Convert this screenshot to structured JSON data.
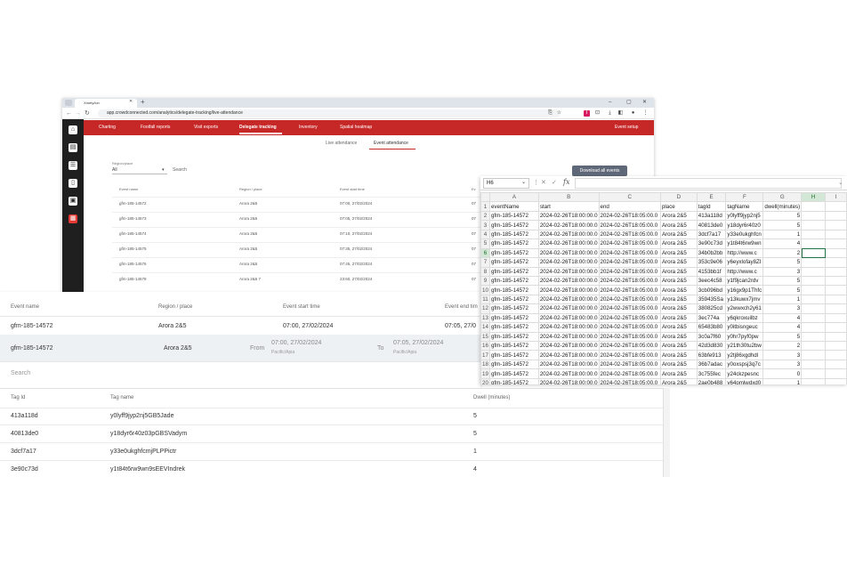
{
  "browser": {
    "tab_title": "Xmety/ion",
    "url": "app.crowdconnected.com/analytics/delegate-tracking/live-attendance",
    "win_min": "–",
    "win_max": "▢",
    "win_close": "✕",
    "app_nav": [
      "Charting",
      "Footfall reports",
      "Visit exports",
      "Delegate tracking",
      "Inventory",
      "Spatial heatmap",
      "Event setup"
    ],
    "sub_tabs": [
      "Live attendance",
      "Event attendance"
    ],
    "region_label": "Region/place",
    "region_value": "All",
    "search_label": "Search",
    "download_button": "Download all events",
    "table_headers": [
      "Event name",
      "Region / place",
      "Event start time",
      "Ev"
    ],
    "rows": [
      [
        "gfm-185-14572",
        "Arora 2&5",
        "07:00, 27/02/2024",
        "07"
      ],
      [
        "gfm-185-14573",
        "Arora 2&5",
        "07:05, 27/02/2024",
        "07"
      ],
      [
        "gfm-185-14574",
        "Arora 2&5",
        "07:10, 27/02/2024",
        "07"
      ],
      [
        "gfm-185-14575",
        "Arora 2&5",
        "07:35, 27/02/2024",
        "07"
      ],
      [
        "gfm-185-14576",
        "Arora 2&5",
        "07:45, 27/02/2024",
        "07"
      ],
      [
        "gfm-185-14578",
        "Arora 2&5 7",
        "23:60, 27/02/2024",
        "07"
      ]
    ]
  },
  "detail": {
    "headers": [
      "Event name",
      "Region / place",
      "Event start time",
      "Event end tim"
    ],
    "row1": [
      "gfm-185-14572",
      "Arora 2&5",
      "07:00, 27/02/2024",
      "07:05, 27/0"
    ],
    "row2": {
      "event": "gfm-185-14572",
      "place": "Arora 2&5",
      "from_label": "From",
      "from_time": "07:00, 27/02/2024",
      "from_tz": "Pacific/Apia",
      "to_label": "To",
      "to_time": "07:05, 27/02/2024",
      "to_tz": "Pacific/Apia"
    },
    "search_placeholder": "Search"
  },
  "tags": {
    "headers": [
      "Tag Id",
      "Tag name",
      "Dwell (minutes)"
    ],
    "rows": [
      [
        "413a118d",
        "y0lyff9jyp2nj5GB5Jade",
        "5"
      ],
      [
        "40813de0",
        "y18dyr6r40z03pGBSVadym",
        "5"
      ],
      [
        "3dcf7a17",
        "y33e0ukghfcmjPLPPictr",
        "1"
      ],
      [
        "3e90c73d",
        "y1t84t6rw9wn9sEEVIndrek",
        "4"
      ]
    ]
  },
  "sheet": {
    "name_box": "H6",
    "cancel_icon": "✕",
    "enter_icon": "✓",
    "fx": "fx",
    "columns": [
      "A",
      "B",
      "C",
      "D",
      "E",
      "F",
      "G",
      "H",
      "I"
    ],
    "header_row": [
      "eventName",
      "start",
      "end",
      "place",
      "tagId",
      "tagName",
      "dwell(minutes)",
      "",
      ""
    ],
    "rows": [
      [
        "gfm-185-14572",
        "2024-02-26T18:00:00.0",
        "2024-02-26T18:05:00.0",
        "Arora 2&5",
        "413a118d",
        "y0lyff9jyp2nj5",
        "5"
      ],
      [
        "gfm-185-14572",
        "2024-02-26T18:00:00.0",
        "2024-02-26T18:05:00.0",
        "Arora 2&5",
        "40813de0",
        "y18dyr6r40z0",
        "5"
      ],
      [
        "gfm-185-14572",
        "2024-02-26T18:00:00.0",
        "2024-02-26T18:05:00.0",
        "Arora 2&5",
        "3dcf7a17",
        "y33e0ukghfcn",
        "1"
      ],
      [
        "gfm-185-14572",
        "2024-02-26T18:00:00.0",
        "2024-02-26T18:05:00.0",
        "Arora 2&5",
        "3e90c73d",
        "y1t84t6rw9wn",
        "4"
      ],
      [
        "gfm-185-14572",
        "2024-02-26T18:00:00.0",
        "2024-02-26T18:05:00.0",
        "Arora 2&5",
        "34b0b2bb",
        "http://www.c",
        "2"
      ],
      [
        "gfm-185-14572",
        "2024-02-26T18:00:00.0",
        "2024-02-26T18:05:00.0",
        "Arora 2&5",
        "353c9e06",
        "y6eyxlofay8ZI",
        "5"
      ],
      [
        "gfm-185-14572",
        "2024-02-26T18:00:00.0",
        "2024-02-26T18:05:00.0",
        "Arora 2&5",
        "4153bb1f",
        "http://www.c",
        "3"
      ],
      [
        "gfm-185-14572",
        "2024-02-26T18:00:00.0",
        "2024-02-26T18:05:00.0",
        "Arora 2&5",
        "3eec4c58",
        "y1f9jcan2rdv",
        "5"
      ],
      [
        "gfm-185-14572",
        "2024-02-26T18:00:00.0",
        "2024-02-26T18:05:00.0",
        "Arora 2&5",
        "3cb096bd",
        "y16gx9p1Thfc",
        "5"
      ],
      [
        "gfm-185-14572",
        "2024-02-26T18:00:00.0",
        "2024-02-26T18:05:00.0",
        "Arora 2&5",
        "359435Sa",
        "y13kuwx7jmv",
        "1"
      ],
      [
        "gfm-185-14572",
        "2024-02-26T18:00:00.0",
        "2024-02-26T18:05:00.0",
        "Arora 2&5",
        "380825cd",
        "y2wwxch2y61",
        "3"
      ],
      [
        "gfm-185-14572",
        "2024-02-26T18:00:00.0",
        "2024-02-26T18:05:00.0",
        "Arora 2&5",
        "3ec774a",
        "y6qkroxuilbz",
        "4"
      ],
      [
        "gfm-185-14572",
        "2024-02-26T18:00:00.0",
        "2024-02-26T18:05:00.0",
        "Arora 2&5",
        "65483b80",
        "y0itbisngeuc",
        "4"
      ],
      [
        "gfm-185-14572",
        "2024-02-26T18:00:00.0",
        "2024-02-26T18:05:00.0",
        "Arora 2&5",
        "3c0a7f60",
        "y0hr7pyf0pw",
        "5"
      ],
      [
        "gfm-185-14572",
        "2024-02-26T18:00:00.0",
        "2024-02-26T18:05:00.0",
        "Arora 2&5",
        "42d3d830",
        "y21th30tu2bw",
        "2"
      ],
      [
        "gfm-185-14572",
        "2024-02-26T18:00:00.0",
        "2024-02-26T18:05:00.0",
        "Arora 2&5",
        "63bfe913",
        "y2tj86xgdhdl",
        "3"
      ],
      [
        "gfm-185-14572",
        "2024-02-26T18:00:00.0",
        "2024-02-26T18:05:00.0",
        "Arora 2&5",
        "36b7adac",
        "y0oxspsj3q7c",
        "3"
      ],
      [
        "gfm-185-14572",
        "2024-02-26T18:00:00.0",
        "2024-02-26T18:05:00.0",
        "Arora 2&5",
        "3c755fec",
        "y24ckzpesnc",
        "0"
      ],
      [
        "gfm-185-14572",
        "2024-02-26T18:00:00.0",
        "2024-02-26T18:05:00.0",
        "Arora 2&5",
        "2ae0b488",
        "y64pmlwdxd0",
        "1"
      ]
    ]
  },
  "colors": {
    "brand_red": "#c62828",
    "sidebar_dark": "#1f1f1f",
    "download_button": "#5f6878",
    "excel_green": "#217346"
  }
}
